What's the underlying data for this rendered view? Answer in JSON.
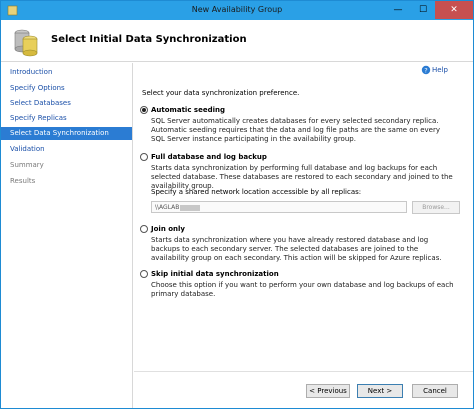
{
  "window": {
    "title": "New Availability Group",
    "min_glyph": "—",
    "max_glyph": "☐",
    "close_glyph": "✕"
  },
  "header": {
    "title": "Select Initial Data Synchronization"
  },
  "sidebar": {
    "items": [
      {
        "label": "Introduction",
        "state": "link"
      },
      {
        "label": "Specify Options",
        "state": "link"
      },
      {
        "label": "Select Databases",
        "state": "link"
      },
      {
        "label": "Specify Replicas",
        "state": "link"
      },
      {
        "label": "Select Data Synchronization",
        "state": "active"
      },
      {
        "label": "Validation",
        "state": "link"
      },
      {
        "label": "Summary",
        "state": "disabled"
      },
      {
        "label": "Results",
        "state": "disabled"
      }
    ]
  },
  "content": {
    "help_label": "Help",
    "prompt": "Select your data synchronization preference.",
    "options": [
      {
        "label": "Automatic seeding",
        "checked": true,
        "description": "SQL Server automatically creates databases for every selected secondary replica. Automatic seeding requires that the data and log file paths are the same on every SQL Server instance participating in the availability group."
      },
      {
        "label": "Full database and log backup",
        "checked": false,
        "description": "Starts data synchronization by performing full database and log backups for each selected database. These databases are restored to each secondary and joined to the availability group."
      },
      {
        "label": "Join only",
        "checked": false,
        "description": "Starts data synchronization where you have already restored database and log backups to each secondary server. The selected databases are joined to the availability group on each secondary. This action will be skipped for Azure replicas."
      },
      {
        "label": "Skip initial data synchronization",
        "checked": false,
        "description": "Choose this option if you want to perform your own database and log backups of each primary database."
      }
    ],
    "share_label": "Specify a shared network location accessible by all replicas:",
    "share_value": "\\\\AGLAB",
    "browse_label": "Browse..."
  },
  "footer": {
    "previous_label": "< Previous",
    "next_label": "Next >",
    "cancel_label": "Cancel"
  }
}
